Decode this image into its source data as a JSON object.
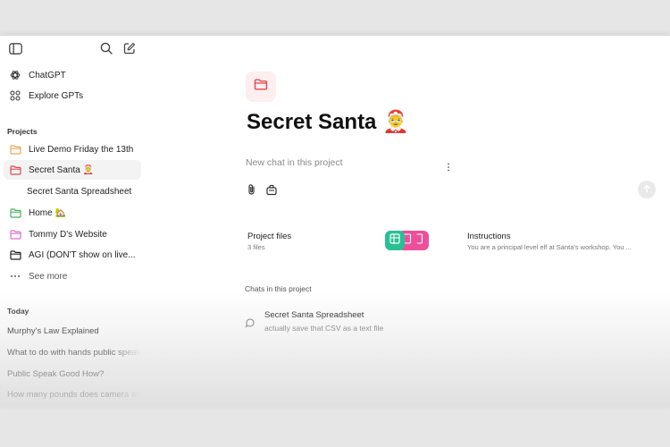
{
  "sidebar": {
    "top_items": [
      {
        "label": "ChatGPT",
        "icon": "openai-icon"
      },
      {
        "label": "Explore GPTs",
        "icon": "grid-icon"
      }
    ],
    "projects_heading": "Projects",
    "projects": [
      {
        "label": "Live Demo Friday the 13th",
        "icon": "folder-icon",
        "color": "#f0a35a"
      },
      {
        "label": "Secret Santa 🤶",
        "icon": "folder-icon",
        "color": "#e5484d"
      },
      {
        "label": "Secret Santa Spreadsheet"
      },
      {
        "label": "Home 🏡",
        "icon": "folder-icon",
        "color": "#46b05b"
      },
      {
        "label": "Tommy D's Website",
        "icon": "folder-icon",
        "color": "#d96fd3"
      },
      {
        "label": "AGI (DON'T show on live...",
        "icon": "folder-icon",
        "color": "#222222"
      }
    ],
    "see_more": "See more",
    "today_heading": "Today",
    "today_chats": [
      "Murphy's Law Explained",
      "What to do with hands public speaking",
      "Public Speak Good How?",
      "How many pounds does camera add"
    ]
  },
  "main": {
    "title": "Secret Santa 🤶",
    "composer_placeholder": "New chat in this project",
    "project_files_label": "Project files",
    "project_files_count": "3 files",
    "instructions_label": "Instructions",
    "instructions_text": "You are a principal level elf at Santa's workshop. You ...",
    "chats_heading": "Chats in this project",
    "chats": [
      {
        "title": "Secret Santa Spreadsheet",
        "snippet": "actually save that CSV as a text file"
      }
    ]
  },
  "colors": {
    "folder_accent": "#e5484d",
    "sheet_chip": "#2bbf94",
    "pink_chip": "#ec4f9b"
  }
}
